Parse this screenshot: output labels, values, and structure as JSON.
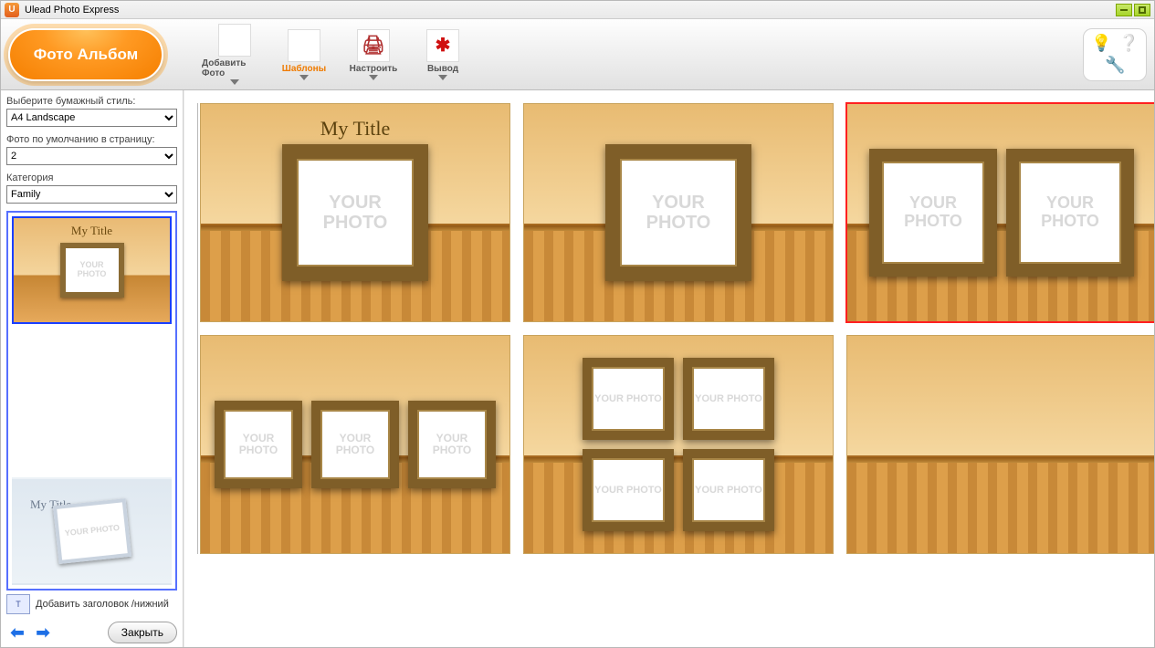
{
  "app": {
    "title": "Ulead Photo Express"
  },
  "toolbar": {
    "photo_album": "Фото Альбом",
    "add_photo": "Добавить Фото",
    "templates": "Шаблоны",
    "settings": "Настроить",
    "output": "Вывод"
  },
  "sidebar": {
    "paper_style_label": "Выберите бумажный стиль:",
    "paper_style_value": "A4 Landscape",
    "default_photos_label": "Фото по умолчанию в страницу:",
    "default_photos_value": "2",
    "category_label": "Категория",
    "category_value": "Family",
    "preview1_title": "My Title",
    "preview2_title": "My Title",
    "placeholder_text": "YOUR PHOTO",
    "add_header_footer": "Добавить заголовок /нижний",
    "close": "Закрыть"
  },
  "templates": {
    "title_text": "My Title",
    "placeholder_text": "YOUR PHOTO",
    "items": [
      {
        "id": 1,
        "frames": 1,
        "size": "lg",
        "has_title": true,
        "selected": false
      },
      {
        "id": 2,
        "frames": 1,
        "size": "lg",
        "has_title": false,
        "selected": false
      },
      {
        "id": 3,
        "frames": 2,
        "size": "md",
        "has_title": false,
        "selected": true
      },
      {
        "id": 4,
        "frames": 3,
        "size": "sm",
        "has_title": false,
        "selected": false
      },
      {
        "id": 5,
        "frames": 4,
        "size": "xs",
        "has_title": false,
        "selected": false
      },
      {
        "id": 6,
        "frames": 0,
        "size": "",
        "has_title": false,
        "selected": false
      }
    ]
  }
}
